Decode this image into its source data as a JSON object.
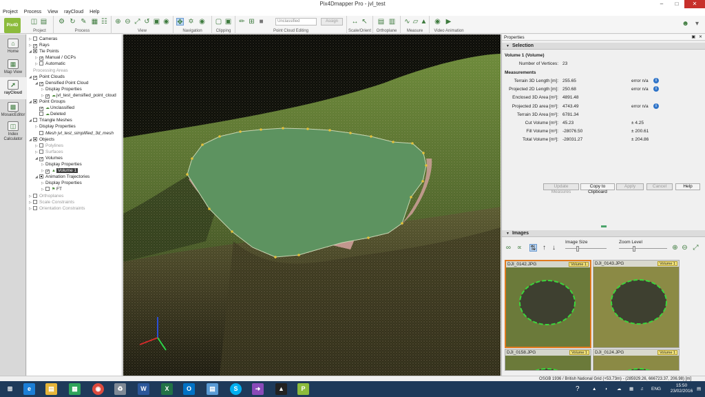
{
  "window": {
    "title": "Pix4Dmapper Pro - jvl_test"
  },
  "menu": [
    "Project",
    "Process",
    "View",
    "rayCloud",
    "Help"
  ],
  "toolbar": {
    "groups": [
      "Project",
      "Process",
      "View",
      "Navigation",
      "Clipping",
      "Point Cloud Editing",
      "Scale/Orient",
      "Orthoplane",
      "Measure",
      "Video Animation"
    ],
    "class_select": "Unclassified",
    "assign_label": "Assign"
  },
  "leftnav": [
    {
      "label": "Home",
      "icon": "home-icon"
    },
    {
      "label": "Map View",
      "icon": "map-icon"
    },
    {
      "label": "rayCloud",
      "icon": "raycloud-icon",
      "active": true
    },
    {
      "label": "MosaicEditor",
      "icon": "mosaic-icon"
    },
    {
      "label": "Index Calculator",
      "icon": "index-icon"
    }
  ],
  "tree": [
    {
      "label": "Cameras",
      "level": 0,
      "check": "none",
      "exp": "right"
    },
    {
      "label": "Rays",
      "level": 0,
      "check": "checked",
      "exp": "right"
    },
    {
      "label": "Tie Points",
      "level": 0,
      "check": "partial",
      "exp": "down"
    },
    {
      "label": "Manual / GCPs",
      "level": 1,
      "check": "checked",
      "exp": "right"
    },
    {
      "label": "Automatic",
      "level": 1,
      "check": "none",
      "exp": "right"
    },
    {
      "label": "Processing Areas",
      "level": 0,
      "check": "hidden",
      "exp": "",
      "grey": true
    },
    {
      "label": "Point Clouds",
      "level": 0,
      "check": "checked",
      "exp": "down"
    },
    {
      "label": "Densified Point Cloud",
      "level": 1,
      "check": "checked",
      "exp": "down"
    },
    {
      "label": "Display Properties",
      "level": 2,
      "check": "hidden",
      "exp": "right"
    },
    {
      "label": "jvl_test_densified_point_cloud",
      "level": 2,
      "check": "checked",
      "exp": "right",
      "leaf": "cloud-icon"
    },
    {
      "label": "Point Groups",
      "level": 0,
      "check": "partial",
      "exp": "down"
    },
    {
      "label": "Unclassified",
      "level": 1,
      "check": "checked",
      "exp": "",
      "leaf": "cloud-icon"
    },
    {
      "label": "Deleted",
      "level": 1,
      "check": "none",
      "exp": "",
      "leaf": "cloud-icon"
    },
    {
      "label": "Triangle Meshes",
      "level": 0,
      "check": "none",
      "exp": "down"
    },
    {
      "label": "Display Properties",
      "level": 1,
      "check": "hidden",
      "exp": "right"
    },
    {
      "label": "Mesh jvl_test_simplified_3d_mesh",
      "level": 1,
      "check": "none",
      "exp": "",
      "italic": true
    },
    {
      "label": "Objects",
      "level": 0,
      "check": "partial",
      "exp": "down"
    },
    {
      "label": "Polylines",
      "level": 1,
      "check": "none",
      "exp": "right",
      "grey": true
    },
    {
      "label": "Surfaces",
      "level": 1,
      "check": "none",
      "exp": "right",
      "grey": true
    },
    {
      "label": "Volumes",
      "level": 1,
      "check": "checked",
      "exp": "down"
    },
    {
      "label": "Display Properties",
      "level": 2,
      "check": "hidden",
      "exp": "right"
    },
    {
      "label": "Volume 1",
      "level": 2,
      "check": "checked",
      "exp": "right",
      "leaf": "volume-icon",
      "selected": true
    },
    {
      "label": "Animation Trajectories",
      "level": 1,
      "check": "partial",
      "exp": "down"
    },
    {
      "label": "Display Properties",
      "level": 2,
      "check": "hidden",
      "exp": "right"
    },
    {
      "label": "FT",
      "level": 2,
      "check": "none",
      "exp": "right",
      "leaf": "trajectory-icon"
    },
    {
      "label": "Orthoplanes",
      "level": 0,
      "check": "none",
      "exp": "right",
      "grey": true
    },
    {
      "label": "Scale Constraints",
      "level": 0,
      "check": "none",
      "exp": "right",
      "grey": true
    },
    {
      "label": "Orientation Constraints",
      "level": 0,
      "check": "none",
      "exp": "right",
      "grey": true
    }
  ],
  "properties": {
    "title": "Properties",
    "selection_header": "Selection",
    "object_name": "Volume 1 (Volume)",
    "vertices_label": "Number of Vertices:",
    "vertices_value": "23",
    "measurements_header": "Measurements",
    "rows": [
      {
        "label": "Terrain 3D Length [m]:",
        "value": "255.65",
        "err": "error n/a",
        "info": true
      },
      {
        "label": "Projected 2D Length [m]:",
        "value": "250.68",
        "err": "error n/a",
        "info": true
      },
      {
        "label": "Enclosed 3D Area [m²]:",
        "value": "4891.48",
        "err": "",
        "info": false
      },
      {
        "label": "Projected 2D area [m²]:",
        "value": "4743.49",
        "err": "error n/a",
        "info": true
      },
      {
        "label": "Terrain 3D Area [m²]:",
        "value": "6781.34",
        "err": "",
        "info": false
      },
      {
        "label": "Cut Volume [m³]:",
        "value": "45.23",
        "err": "± 4.25",
        "info": false
      },
      {
        "label": "Fill Volume [m³]:",
        "value": "-28076.50",
        "err": "± 200.61",
        "info": false
      },
      {
        "label": "Total Volume [m³]:",
        "value": "-28031.27",
        "err": "± 204.86",
        "info": false
      }
    ],
    "buttons": {
      "update": "Update Measures",
      "copy": "Copy to Clipboard",
      "apply": "Apply",
      "cancel": "Cancel",
      "help": "Help"
    }
  },
  "images": {
    "header": "Images",
    "image_size_label": "Image Size",
    "zoom_level_label": "Zoom Level",
    "tiles": [
      {
        "name": "DJI_0142.JPG",
        "badge": "Volume 1",
        "selected": true
      },
      {
        "name": "DJI_0143.JPG",
        "badge": "Volume 1",
        "selected": false
      },
      {
        "name": "DJI_0158.JPG",
        "badge": "Volume 1",
        "selected": false
      },
      {
        "name": "DJI_0124.JPG",
        "badge": "Volume 1",
        "selected": false
      }
    ]
  },
  "status": {
    "text": "OSGB 1936 / British National Grid (+53.73m) - (285929.26, 666723.37, 206.98) [m]"
  },
  "taskbar": {
    "apps": [
      "windows-icon",
      "ie-icon",
      "explorer-icon",
      "store-icon",
      "chrome-icon",
      "recycle-icon",
      "word-icon",
      "excel-icon",
      "outlook-icon",
      "notepad-icon",
      "skype-icon",
      "arrow-app-icon",
      "inkscape-icon",
      "pix4d-icon"
    ],
    "lang": "ENG",
    "time": "15:50",
    "date": "23/02/2016"
  },
  "colors": {
    "accent": "#3d7a3d",
    "volume_fill": "#5d9360",
    "selection_orange": "#e07a1f",
    "taskbar": "#1e3a5a"
  }
}
